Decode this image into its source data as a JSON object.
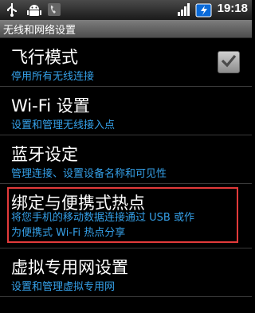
{
  "status_bar": {
    "time": "19:18",
    "icons": [
      "usb-icon",
      "android-debug-icon",
      "phone-icon",
      "signal-icon",
      "battery-charging-icon"
    ]
  },
  "window": {
    "title": "无线和网络设置"
  },
  "settings": [
    {
      "title": "飞行模式",
      "subtitle": "停用所有无线连接",
      "checked": true
    },
    {
      "title": "Wi-Fi 设置",
      "subtitle": "设置和管理无线接入点"
    },
    {
      "title": "蓝牙设定",
      "subtitle": "管理连接、设置设备名称和可见性"
    },
    {
      "title": "绑定与便携式热点",
      "subtitle_line1": "将您手机的移动数据连接通过 USB 或作",
      "subtitle_line2": "为便携式 Wi-Fi 热点分享"
    },
    {
      "title": "虚拟专用网设置",
      "subtitle": "设置和管理虚拟专用网"
    }
  ],
  "colors": {
    "accent": "#35a0e8",
    "highlight": "#e23a3a"
  }
}
